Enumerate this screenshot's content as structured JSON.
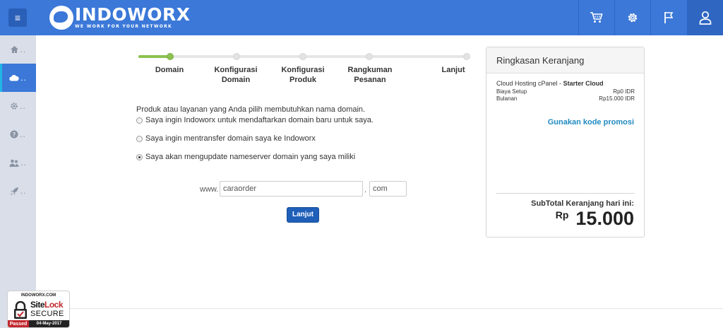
{
  "header": {
    "logo_text": "INDOWORX",
    "logo_tagline": "WE WORK FOR YOUR NETWORK",
    "menu_icon": "hamburger-icon",
    "actions": [
      "cart-icon",
      "gear-icon",
      "flag-icon",
      "user-icon"
    ]
  },
  "sidebar": {
    "items": [
      {
        "icon": "home-icon",
        "dots": "..",
        "active": false
      },
      {
        "icon": "cloud-icon",
        "dots": "..",
        "active": true
      },
      {
        "icon": "gear-icon",
        "dots": "..",
        "active": false
      },
      {
        "icon": "help-icon",
        "dots": "..",
        "active": false
      },
      {
        "icon": "users-icon",
        "dots": "..",
        "active": false
      },
      {
        "icon": "rocket-icon",
        "dots": "..",
        "active": false
      }
    ]
  },
  "steps": {
    "current": 1,
    "total": 5,
    "labels": [
      [
        "Domain"
      ],
      [
        "Konfigurasi",
        "Domain"
      ],
      [
        "Konfigurasi",
        "Produk"
      ],
      [
        "Rangkuman",
        "Pesanan"
      ],
      [
        "Lanjut"
      ]
    ]
  },
  "domain_form": {
    "intro": "Produk atau layanan yang Anda pilih membutuhkan nama domain.",
    "options": [
      {
        "label": "Saya ingin Indoworx untuk mendaftarkan domain baru untuk saya.",
        "checked": false
      },
      {
        "label": "Saya ingin mentransfer domain saya ke Indoworx",
        "checked": false
      },
      {
        "label": "Saya akan mengupdate nameserver domain yang saya miliki",
        "checked": true
      }
    ],
    "www_prefix": "www.",
    "domain_value": "caraorder",
    "separator": ".",
    "tld_value": "com",
    "submit_label": "Lanjut"
  },
  "cart": {
    "title": "Ringkasan Keranjang",
    "product_prefix": "Cloud Hosting cPanel - ",
    "product_name": "Starter Cloud",
    "rows": [
      {
        "label": "Biaya Setup",
        "value": "Rp0 IDR"
      },
      {
        "label": "Bulanan",
        "value": "Rp15.000 IDR"
      }
    ],
    "promo_label": "Gunakan kode promosi",
    "subtotal_label": "SubTotal Keranjang hari ini:",
    "currency": "Rp",
    "total": "15.000"
  },
  "sitelock": {
    "domain": "INDOWORX.COM",
    "brand_site": "Site",
    "brand_lock": "Lock",
    "secure": "SECURE",
    "passed": "Passed",
    "date": "04-May-2017",
    "accent": "#c1272d"
  },
  "colors": {
    "primary": "#3b78d8",
    "progress": "#8cc152",
    "promo": "#1f8ac0",
    "button": "#1f5fb8"
  }
}
